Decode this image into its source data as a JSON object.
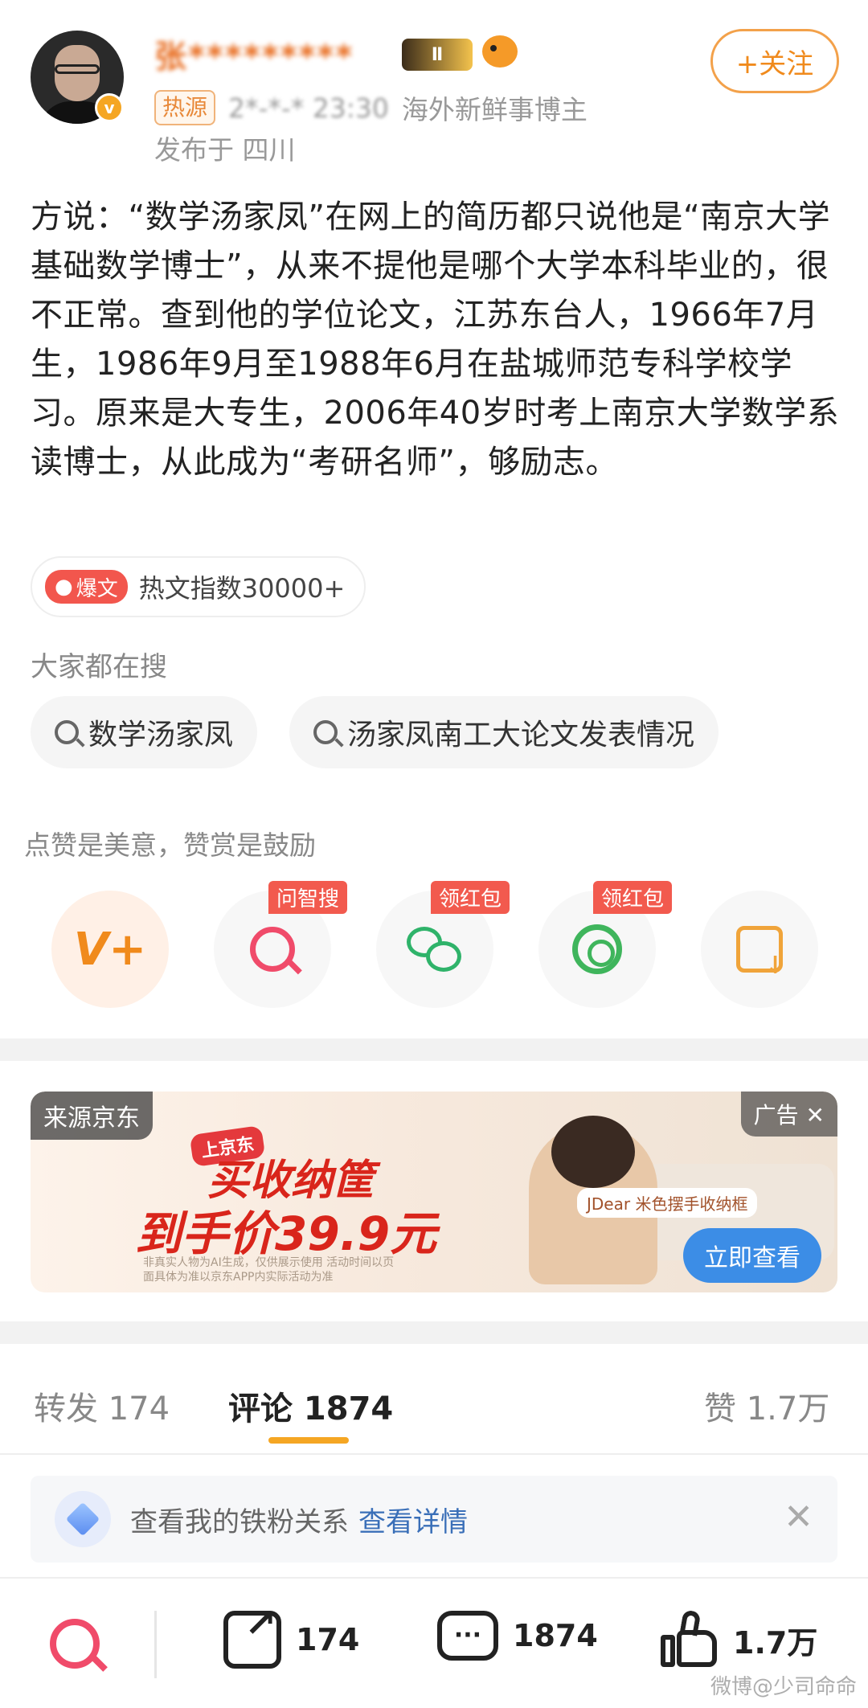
{
  "header": {
    "username": "张*********",
    "level_badge": "Ⅱ",
    "follow_label": "+关注",
    "hot_source_tag": "热源",
    "time": "2*-*-* 23:30",
    "title": "海外新鲜事博主",
    "location": "发布于 四川"
  },
  "post": {
    "text": "方说：“数学汤家凤”在网上的简历都只说他是“南京大学基础数学博士”，从来不提他是哪个大学本科毕业的，很不正常。查到他的学位论文，江苏东台人，1966年7月生，1986年9月至1988年6月在盐城师范专科学校学习。原来是大专生，2006年40岁时考上南京大学数学系读博士，从此成为“考研名师”，够励志。"
  },
  "hot_index": {
    "badge": "爆文",
    "text": "热文指数30000+"
  },
  "search": {
    "title": "大家都在搜",
    "chips": [
      "数学汤家凤",
      "汤家凤南工大论文发表情况"
    ]
  },
  "praise": {
    "text": "点赞是美意，赞赏是鼓励",
    "ribbons": [
      "问智搜",
      "领红包",
      "领红包"
    ]
  },
  "ad": {
    "source": "来源京东",
    "label": "广告 ✕",
    "brand": "上京东",
    "line1": "买收纳筐",
    "line2": "到手价39.9元",
    "small_print": "非真实人物为AI生成，仅供展示使用 活动时间以页面具体为准以京东APP内实际活动为准",
    "product_tag": "JDear 米色摆手收纳框",
    "cta": "立即查看"
  },
  "tabs": {
    "repost": "转发 174",
    "comments": "评论 1874",
    "likes": "赞 1.7万"
  },
  "fan_bar": {
    "text": "查看我的铁粉关系",
    "link": "查看详情",
    "close": "✕"
  },
  "bottom_bar": {
    "repost_count": "174",
    "comment_count": "1874",
    "like_count": "1.7万"
  },
  "watermark": "微博@少司命命",
  "colors": {
    "accent_orange": "#f08a1c",
    "hot_red": "#f2564d",
    "link_blue": "#3a6fb8",
    "tab_indicator": "#f5a623"
  }
}
